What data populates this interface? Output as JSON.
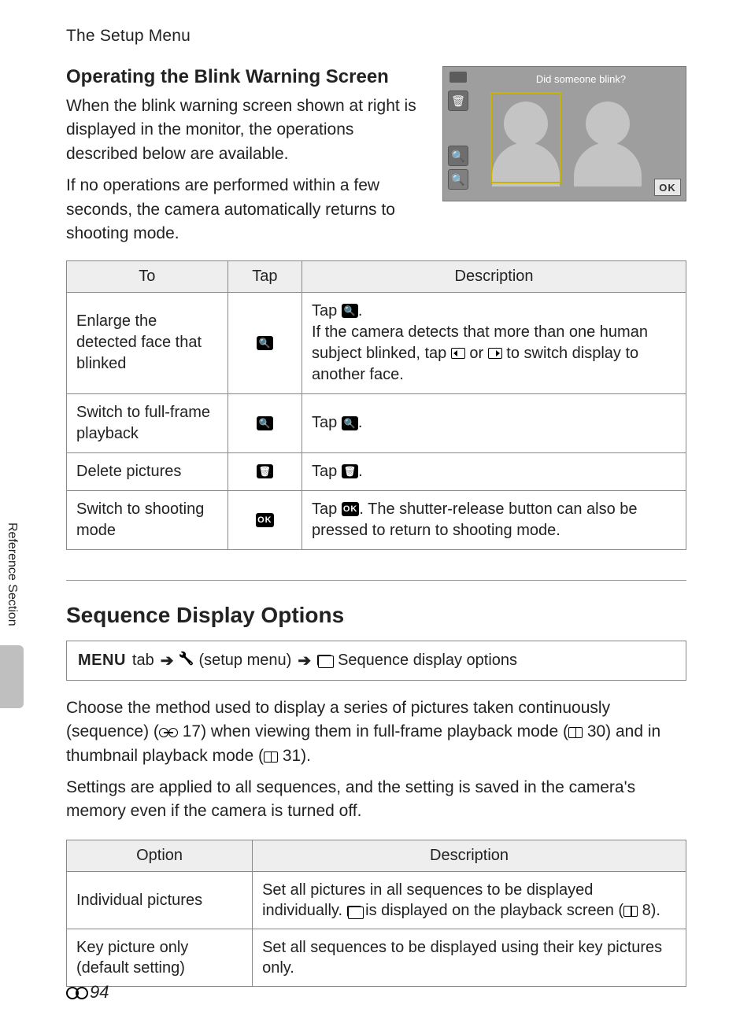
{
  "running_head": "The Setup Menu",
  "section1": {
    "heading": "Operating the Blink Warning Screen",
    "para1": "When the blink warning screen shown at right is displayed in the monitor, the operations described below are available.",
    "para2": "If no operations are performed within a few seconds, the camera automatically returns to shooting mode.",
    "screen_caption": "Did someone blink?",
    "ok_label": "OK"
  },
  "table1": {
    "head": {
      "to": "To",
      "tap": "Tap",
      "desc": "Description"
    },
    "rows": [
      {
        "to": "Enlarge the detected face that blinked",
        "tap_icon": "zoom-in-icon",
        "tap_glyph": "🔍",
        "desc_pre": "Tap ",
        "desc_mid": ".\nIf the camera detects that more than one human subject blinked, tap ",
        "desc_or": " or ",
        "desc_post": " to switch display to another face."
      },
      {
        "to": "Switch to full-frame playback",
        "tap_icon": "zoom-out-icon",
        "tap_glyph": "🔍",
        "desc_pre": "Tap ",
        "desc_post": "."
      },
      {
        "to": "Delete pictures",
        "tap_icon": "trash-icon",
        "tap_glyph": "🗑",
        "desc_pre": "Tap ",
        "desc_post": "."
      },
      {
        "to": "Switch to shooting mode",
        "tap_icon": "ok-icon",
        "tap_glyph": "OK",
        "desc_pre": "Tap ",
        "desc_post": ". The shutter-release button can also be pressed to return to shooting mode."
      }
    ]
  },
  "section2": {
    "heading": "Sequence Display Options",
    "path": {
      "menu": "MENU",
      "tab_word": "tab",
      "setup": "(setup menu)",
      "leaf": "Sequence display options"
    },
    "para1a": "Choose the method used to display a series of pictures taken continuously (sequence) (",
    "ref1": "17",
    "para1b": ") when viewing them in full-frame playback mode (",
    "ref2": "30",
    "para1c": ") and in thumbnail playback mode (",
    "ref3": "31",
    "para1d": ").",
    "para2": "Settings are applied to all sequences, and the setting is saved in the camera's memory even if the camera is turned off."
  },
  "table2": {
    "head": {
      "option": "Option",
      "desc": "Description"
    },
    "rows": [
      {
        "option": "Individual pictures",
        "desc_a": "Set all pictures in all sequences to be displayed individually. ",
        "desc_b": " is displayed on the playback screen (",
        "ref": "8",
        "desc_c": ")."
      },
      {
        "option": "Key picture only (default setting)",
        "desc": "Set all sequences to be displayed using their key pictures only."
      }
    ]
  },
  "side_tab": "Reference Section",
  "page_num": "94"
}
